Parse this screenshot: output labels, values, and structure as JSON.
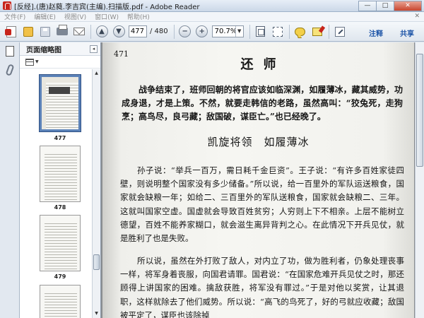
{
  "window": {
    "title": "[反经].(唐)赵蕤.李吉宾(主编).扫描版.pdf - Adobe Reader",
    "minimize": "—",
    "maximize": "□",
    "close": "✕"
  },
  "menu": {
    "items": [
      "文件(F)",
      "编辑(E)",
      "视图(V)",
      "窗口(W)",
      "帮助(H)"
    ],
    "close_glyph": "✕"
  },
  "toolbar": {
    "current_page": "477",
    "total_pages": "/ 480",
    "zoom": "70.7%",
    "prev_glyph": "▲",
    "next_glyph": "▼",
    "zoom_out_glyph": "−",
    "zoom_in_glyph": "+",
    "dropdown_glyph": "▼",
    "comment_label": "注释",
    "share_label": "共享"
  },
  "panel": {
    "title": "页面缩略图",
    "collapse_glyph": "◂",
    "thumbnails": [
      {
        "label": "477"
      },
      {
        "label": "478"
      },
      {
        "label": "479"
      }
    ]
  },
  "document": {
    "page_number": "471",
    "chapter_title": "还师",
    "intro": "战争结束了，班师回朝的将官应该如临深渊，如履薄冰，藏其威势，功成身退，才是上策。不然，就要走韩信的老路，虽然高叫：“狡兔死，走狗烹；高鸟尽，良弓藏；敌国破，谋臣亡。”也已经晚了。",
    "section_title": "凯旋将领　如履薄冰",
    "paragraph_1": "孙子说：“举兵一百万，需日耗千金巨资”。王子说：“有许多百姓家徒四壁，则说明整个国家没有多少储备。”所以说，给一百里外的军队运送粮食，国家就会缺粮一年；如给二、三百里外的军队送粮食，国家就会缺粮二、三年。这就叫国家空虚。国虚就会导致百姓贫穷；人穷则上下不相亲。上层不能树立德望，百姓不能养家糊口，就会滋生离异背判之心。在此情况下开兵见仗，就是胜利了也是失败。",
    "paragraph_2": "所以说，虽然在外打败了敌人，对内立了功，做为胜利者，仍象处理丧事一样，将军身着丧服，向国君请罪。国君说：“在国家危难开兵见仗之时，那还顾得上讲国家的困难。擒敌获胜，将军没有罪过。”于是对他以奖赏，让其退职，这样就除去了他们威势。所以说：“高飞的鸟死了，好的弓就应收藏；敌国被平定了，谋臣也该除掉"
  }
}
